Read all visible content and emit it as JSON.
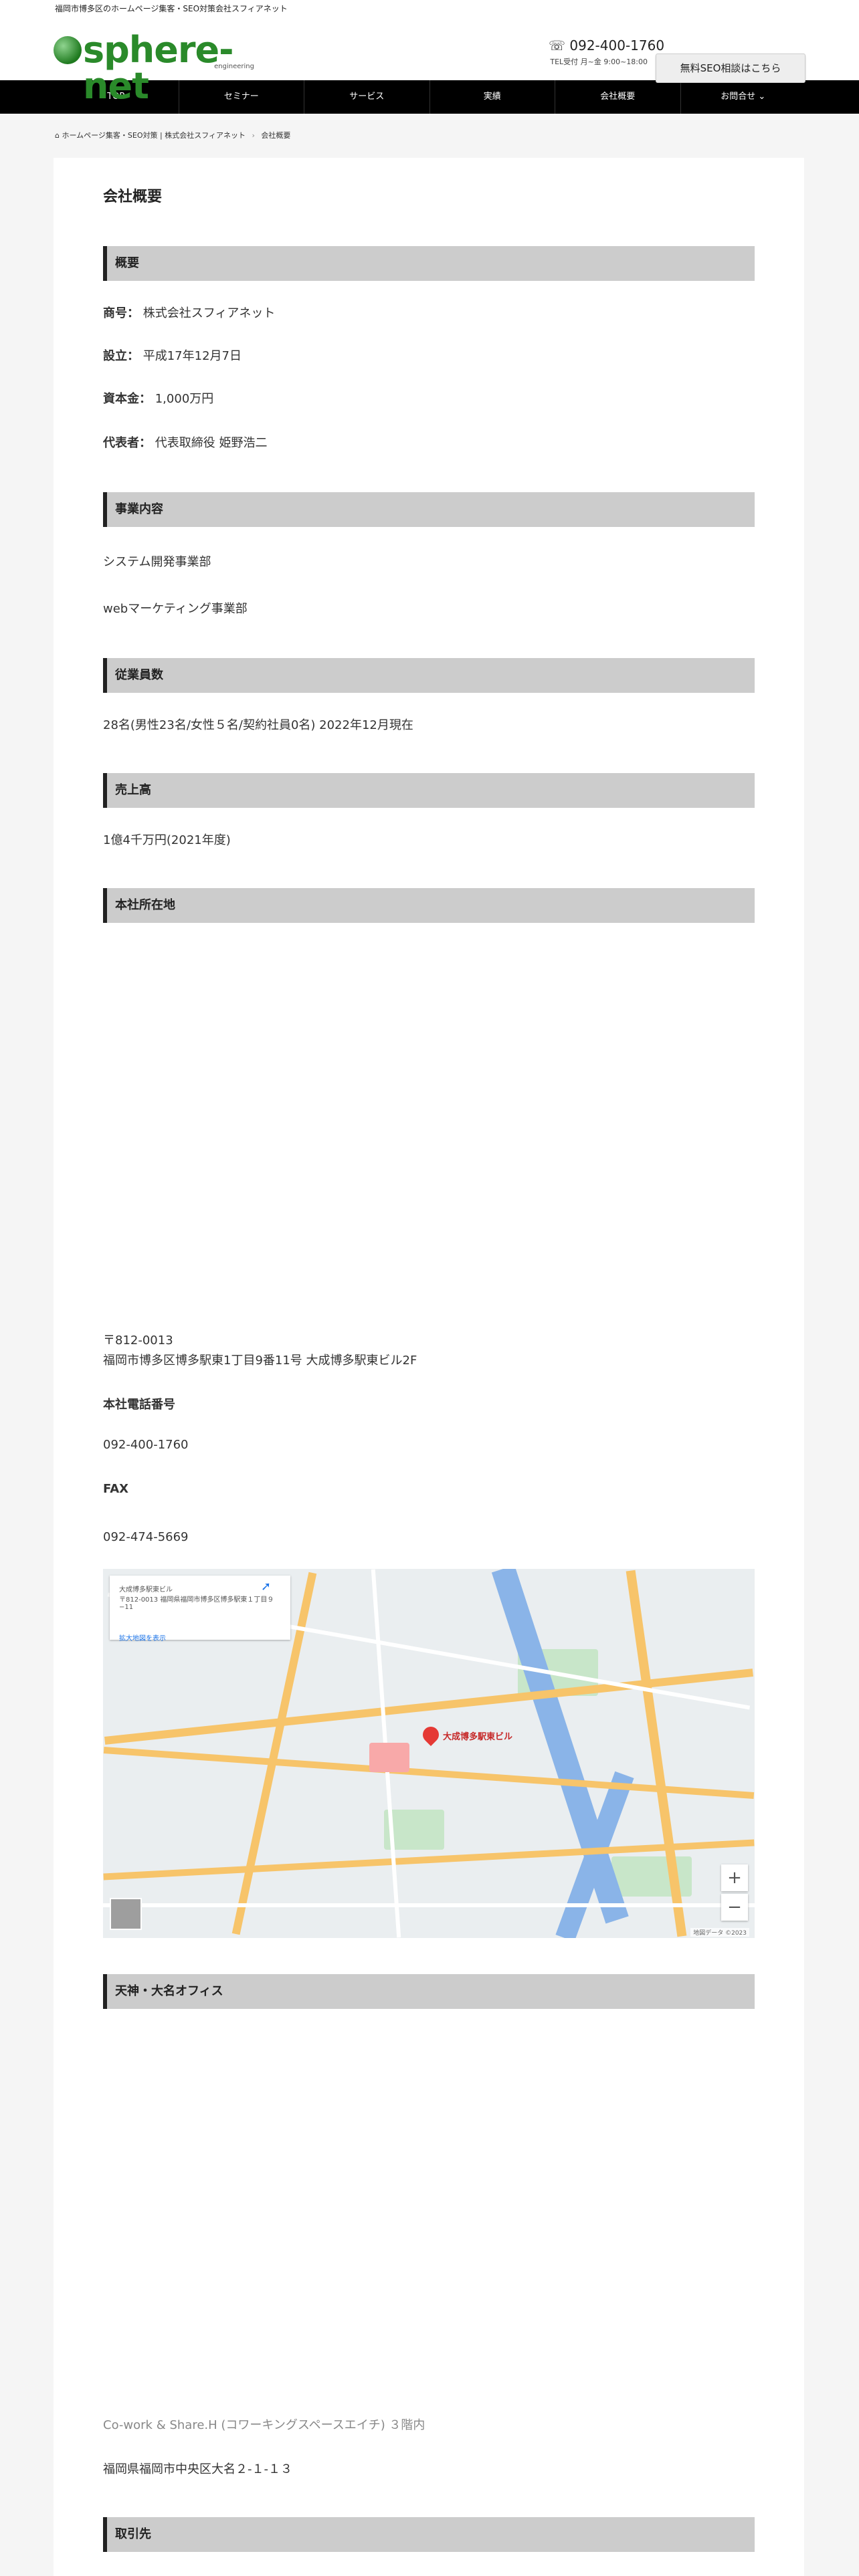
{
  "topbar": {
    "text": "福岡市博多区のホームページ集客・SEO対策会社スフィアネット"
  },
  "header": {
    "logo_text": "sphere-net",
    "logo_sub": "engineering",
    "tel": "092-400-1760",
    "tel_hours": "TEL受付 月~金 9:00~18:00",
    "cta_label": "無料SEO相談はこちら"
  },
  "nav": {
    "items": [
      "TOP",
      "セミナー",
      "サービス",
      "実績",
      "会社概要",
      "お問合せ ⌄"
    ]
  },
  "breadcrumb": {
    "home": "ホームページ集客・SEO対策 | 株式会社スフィアネット",
    "sep": "›",
    "current": "会社概要"
  },
  "page": {
    "title": "会社概要",
    "sec_overview": "概要",
    "trade_label": "商号：",
    "trade_value": "株式会社スフィアネット",
    "founded_label": "設立：",
    "founded_value": "平成17年12月7日",
    "capital_label": "資本金：",
    "capital_value": "1,000万円",
    "rep_label": "代表者：",
    "rep_value": "代表取締役 姫野浩二",
    "sec_business": "事業内容",
    "business_1": "システム開発事業部",
    "business_2": "webマーケティング事業部",
    "sec_employees": "従業員数",
    "employees": "28名(男性23名/女性５名/契約社員0名) 2022年12月現在",
    "sec_sales": "売上高",
    "sales": "1億4千万円(2021年度)",
    "sec_hq": "本社所在地",
    "postal": "〒812-0013",
    "address": "福岡市博多区博多駅東1丁目9番11号 大成博多駅東ビル2F",
    "hq_tel_label": "本社電話番号",
    "hq_tel": "092-400-1760",
    "fax_label": "FAX",
    "fax": "092-474-5669",
    "sec_tenjin": "天神・大名オフィス",
    "tenjin_place": "Co-work & Share.H (コワーキングスペースエイチ) ３階内",
    "tenjin_address": "福岡県福岡市中央区大名２-１-１３",
    "sec_clients": "取引先"
  },
  "map": {
    "card_title": "大成博多駅東ビル",
    "card_address": "〒812-0013 福岡県福岡市博多区博多駅東１丁目９−11",
    "card_link": "拡大地図を表示",
    "pin_label": "大成博多駅東ビル",
    "zoom_in": "+",
    "zoom_out": "−",
    "credit": "地図データ ©2023"
  }
}
